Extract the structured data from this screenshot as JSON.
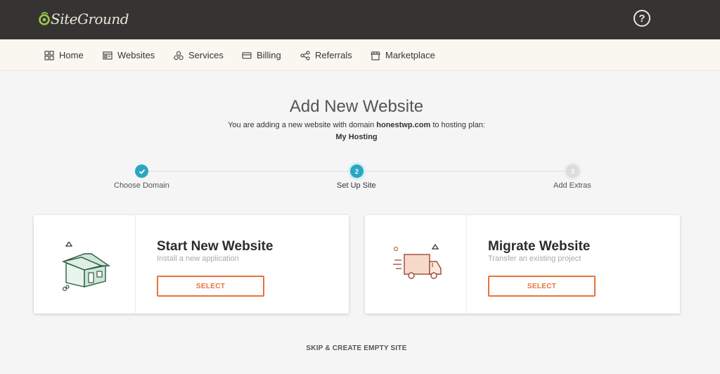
{
  "brand": {
    "name": "SiteGround",
    "accent": "#e8733a",
    "teal": "#2aa6c3",
    "logo_green": "#9bc848"
  },
  "header": {
    "help_icon": "question-circle-icon",
    "help_symbol": "?"
  },
  "nav": {
    "items": [
      {
        "label": "Home",
        "icon": "home-grid-icon"
      },
      {
        "label": "Websites",
        "icon": "websites-icon"
      },
      {
        "label": "Services",
        "icon": "services-icon"
      },
      {
        "label": "Billing",
        "icon": "billing-card-icon"
      },
      {
        "label": "Referrals",
        "icon": "referrals-share-icon"
      },
      {
        "label": "Marketplace",
        "icon": "marketplace-store-icon"
      }
    ]
  },
  "page": {
    "title": "Add New Website",
    "subtitle_prefix": "You are adding a new website with domain ",
    "domain": "honestwp.com",
    "subtitle_suffix": " to hosting plan:",
    "plan": "My Hosting"
  },
  "stepper": {
    "steps": [
      {
        "number": "1",
        "label": "Choose Domain",
        "state": "done"
      },
      {
        "number": "2",
        "label": "Set Up Site",
        "state": "active"
      },
      {
        "number": "3",
        "label": "Add Extras",
        "state": "pending"
      }
    ]
  },
  "cards": [
    {
      "title": "Start New Website",
      "description": "Install a new application",
      "button": "SELECT",
      "icon": "house-icon"
    },
    {
      "title": "Migrate Website",
      "description": "Transfer an existing project",
      "button": "SELECT",
      "icon": "moving-truck-icon"
    }
  ],
  "footer": {
    "skip_label": "SKIP & CREATE EMPTY SITE"
  }
}
